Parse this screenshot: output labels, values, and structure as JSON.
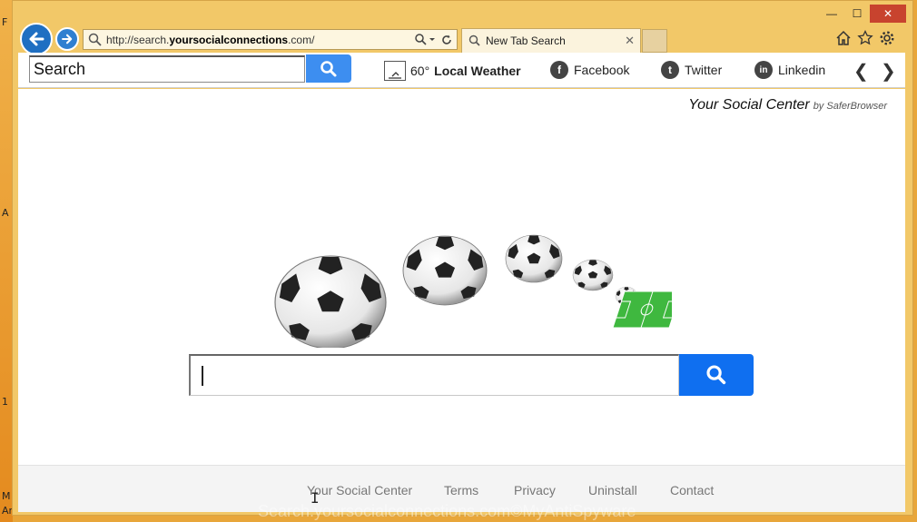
{
  "desktop": {
    "edge_letters": [
      "F",
      "A",
      "1",
      "M",
      "Ar"
    ]
  },
  "window": {
    "controls": {
      "minimize": "—",
      "maximize": "☐",
      "close": "✕"
    }
  },
  "address_bar": {
    "url_prefix": "http://search.",
    "url_domain": "yoursocialconnections",
    "url_suffix": ".com/"
  },
  "tab": {
    "label": "New Tab Search",
    "close": "✕"
  },
  "toolbar": {
    "search_value": "Search",
    "weather": {
      "temp": "60°",
      "label": "Local Weather"
    },
    "links": [
      {
        "label": "Facebook",
        "glyph": "f"
      },
      {
        "label": "Twitter",
        "glyph": "t"
      },
      {
        "label": "Linkedin",
        "glyph": "in"
      }
    ],
    "prev": "❮",
    "next": "❯"
  },
  "content": {
    "brand": "Your Social Center",
    "brand_by": "by SaferBrowser",
    "search_value": ""
  },
  "footer": {
    "links": [
      "Your Social Center",
      "Terms",
      "Privacy",
      "Uninstall",
      "Contact"
    ]
  },
  "watermark": "Search.yoursocialconnections.com©MyAntiSpyware",
  "colors": {
    "accent_blue": "#0f6ff0",
    "toolbar_blue": "#3d8ef0",
    "frame": "#f2c868",
    "close_red": "#c8432e"
  }
}
